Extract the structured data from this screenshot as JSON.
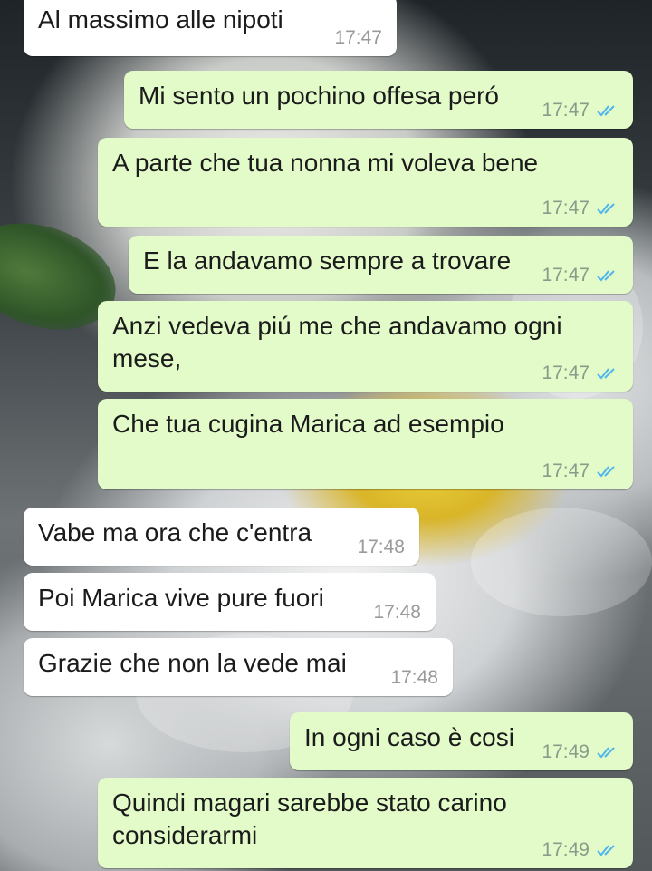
{
  "colors": {
    "incoming_bubble": "#ffffff",
    "outgoing_bubble": "#e2fbc9",
    "read_ticks": "#4fb6ec",
    "timestamp": "#8b9a8a"
  },
  "messages": [
    {
      "direction": "incoming",
      "text": "Al massimo alle nipoti",
      "time": "17:47"
    },
    {
      "direction": "outgoing",
      "text": "Mi sento un pochino offesa peró",
      "time": "17:47",
      "status_icon": "double-check-read-icon"
    },
    {
      "direction": "outgoing",
      "text": "A parte che tua nonna mi voleva bene",
      "time": "17:47",
      "status_icon": "double-check-read-icon"
    },
    {
      "direction": "outgoing",
      "text": "E la andavamo sempre a trovare",
      "time": "17:47",
      "status_icon": "double-check-read-icon"
    },
    {
      "direction": "outgoing",
      "text_line1": "Anzi vedeva piú me che andavamo ogni",
      "text_line2": "mese,",
      "time": "17:47",
      "status_icon": "double-check-read-icon"
    },
    {
      "direction": "outgoing",
      "text": "Che tua cugina Marica ad esempio",
      "time": "17:47",
      "status_icon": "double-check-read-icon"
    },
    {
      "direction": "incoming",
      "text": "Vabe ma ora che c'entra",
      "time": "17:48"
    },
    {
      "direction": "incoming",
      "text": "Poi Marica vive pure fuori",
      "time": "17:48"
    },
    {
      "direction": "incoming",
      "text": "Grazie che non la vede mai",
      "time": "17:48"
    },
    {
      "direction": "outgoing",
      "text": "In ogni caso è cosi",
      "time": "17:49",
      "status_icon": "double-check-read-icon"
    },
    {
      "direction": "outgoing",
      "text_line1": "Quindi magari sarebbe stato carino",
      "text_line2": "considerarmi",
      "time": "17:49",
      "status_icon": "double-check-read-icon"
    }
  ]
}
